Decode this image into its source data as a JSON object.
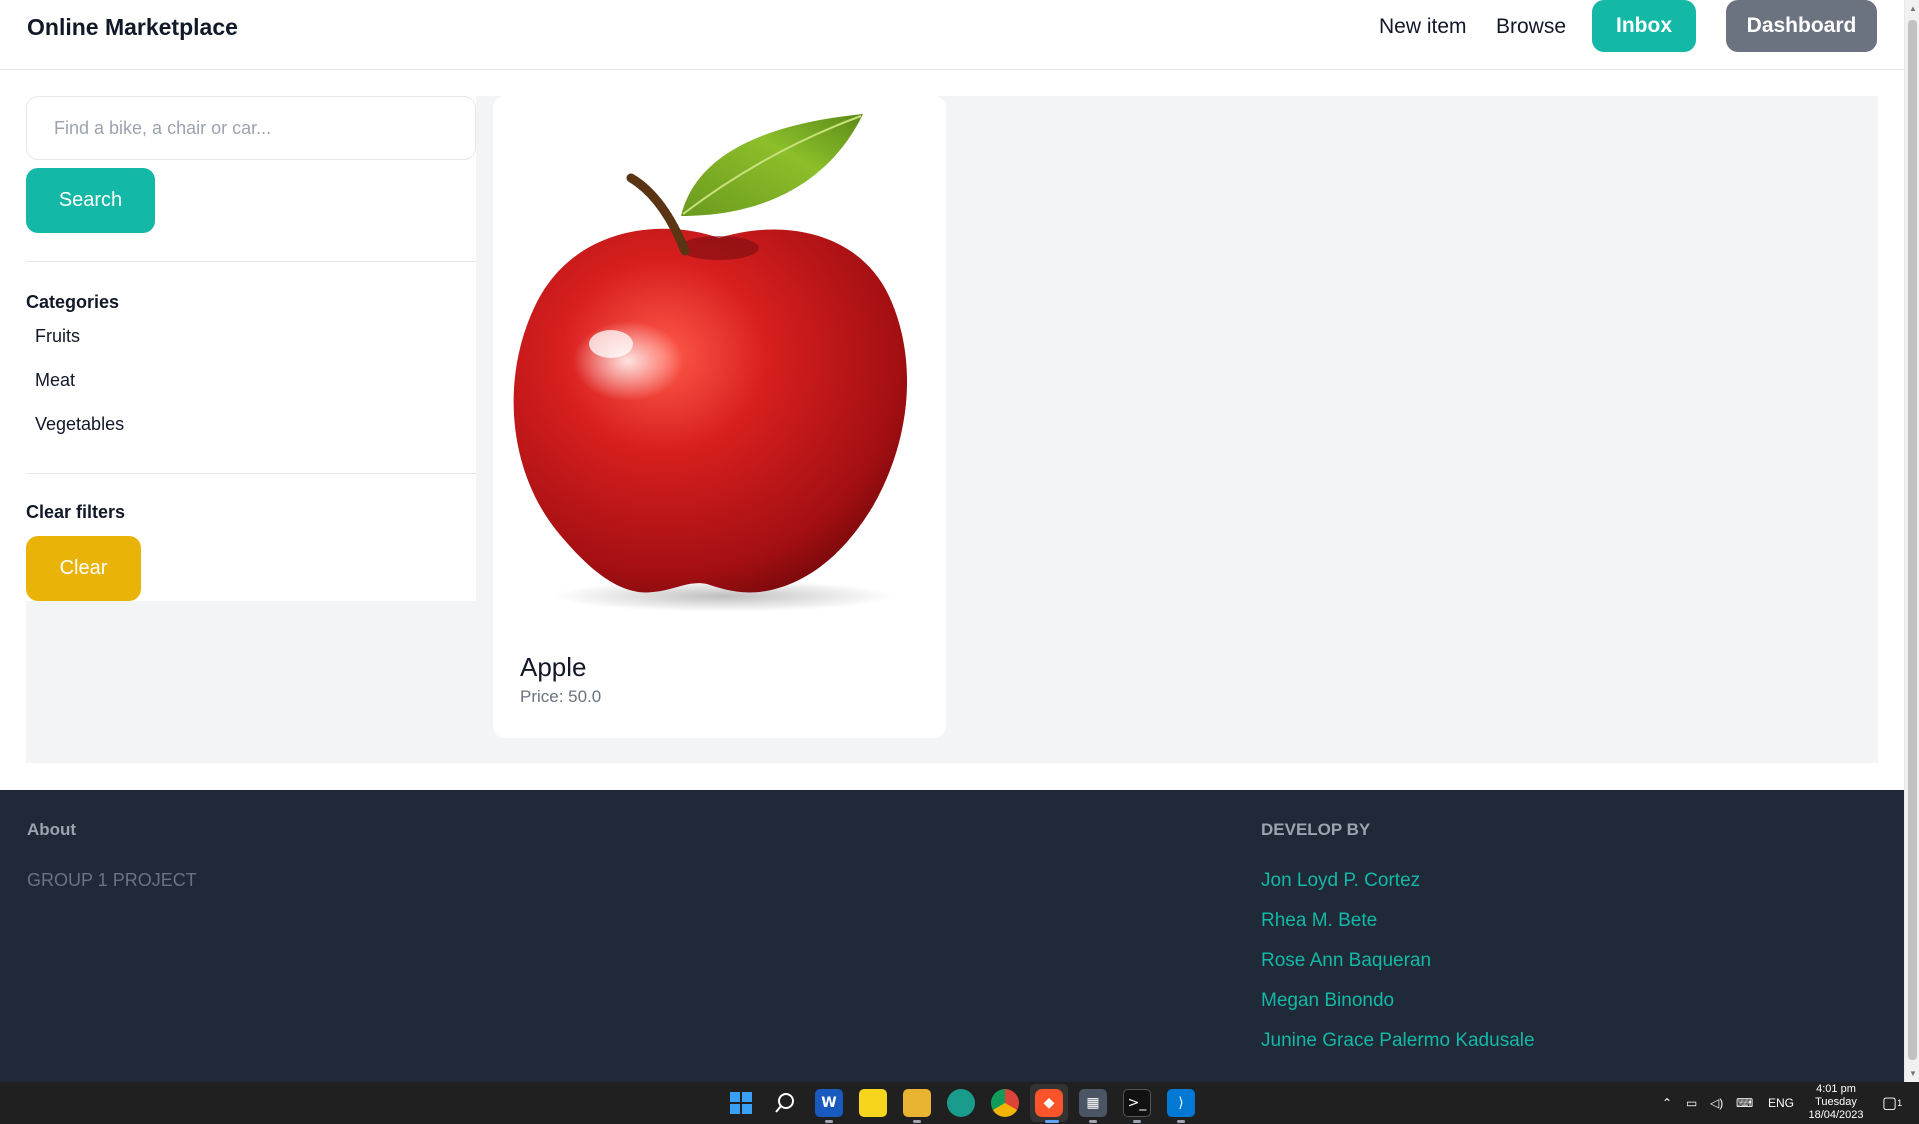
{
  "nav": {
    "brand": "Online Marketplace",
    "new_item": "New item",
    "browse": "Browse",
    "inbox": "Inbox",
    "dashboard": "Dashboard"
  },
  "sidebar": {
    "search_placeholder": "Find a bike, a chair or car...",
    "search_button": "Search",
    "categories_title": "Categories",
    "categories": [
      "Fruits",
      "Meat",
      "Vegetables"
    ],
    "clear_title": "Clear filters",
    "clear_button": "Clear"
  },
  "items": [
    {
      "name": "Apple",
      "price_label": "Price: 50.0"
    }
  ],
  "footer": {
    "about_title": "About",
    "about_text": "GROUP 1 PROJECT",
    "developers_title": "DEVELOP BY",
    "developers": [
      "Jon Loyd P. Cortez",
      "Rhea M. Bete",
      "Rose Ann Baqueran",
      "Megan Binondo",
      "Junine Grace Palermo Kadusale"
    ]
  },
  "taskbar": {
    "language": "ENG",
    "time": "4:01 pm",
    "day": "Tuesday",
    "date": "18/04/2023",
    "notification_count": "1"
  },
  "colors": {
    "accent": "#14b8a6",
    "clear": "#eab308",
    "dashboard": "#6b7280",
    "footer_bg": "#1f2937"
  }
}
